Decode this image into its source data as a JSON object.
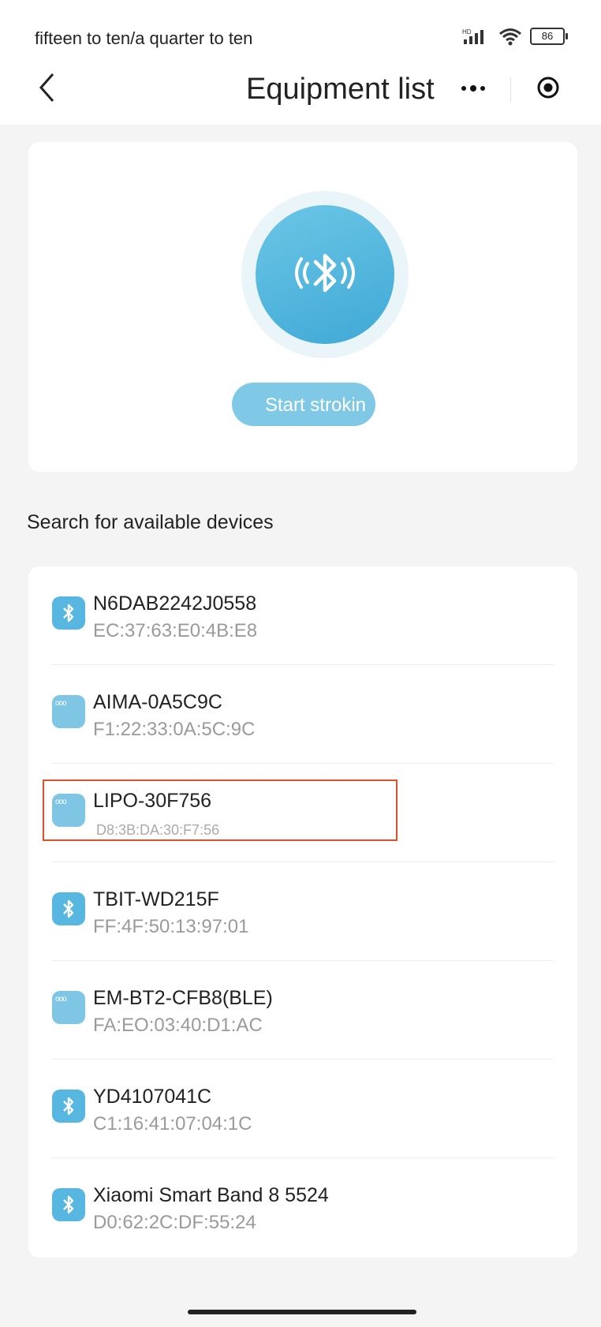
{
  "status_bar": {
    "time": "fifteen to ten/a quarter to ten",
    "signal_badge": "HD",
    "battery": "86"
  },
  "header": {
    "title": "Equipment list",
    "more_icon": "more-dots-icon",
    "target_icon": "record-target-icon",
    "back_icon": "chevron-left-icon"
  },
  "scan": {
    "icon": "bluetooth-icon",
    "start_label": "Start strokin"
  },
  "section_label": "Search for available devices",
  "devices": [
    {
      "name": "N6DAB2242J0558",
      "mac": "EC:37:63:E0:4B:E8",
      "icon": "bluetooth"
    },
    {
      "name": "AIMA-0A5C9C",
      "mac": "F1:22:33:0A:5C:9C",
      "icon": "generic"
    },
    {
      "name": "LIPO-30F756",
      "mac": "D8:3B:DA:30:F7:56",
      "icon": "generic"
    },
    {
      "name": "TBIT-WD215F",
      "mac": "FF:4F:50:13:97:01",
      "icon": "bluetooth"
    },
    {
      "name": "EM-BT2-CFB8(BLE)",
      "mac": "FA:EO:03:40:D1:AC",
      "icon": "generic"
    },
    {
      "name": "YD4107041C",
      "mac": "C1:16:41:07:04:1C",
      "icon": "bluetooth"
    },
    {
      "name": "Xiaomi Smart Band 8 5524",
      "mac": "D0:62:2C:DF:55:24",
      "icon": "bluetooth"
    }
  ],
  "colors": {
    "accent": "#3fa9d5",
    "highlight": "#d9542b"
  }
}
